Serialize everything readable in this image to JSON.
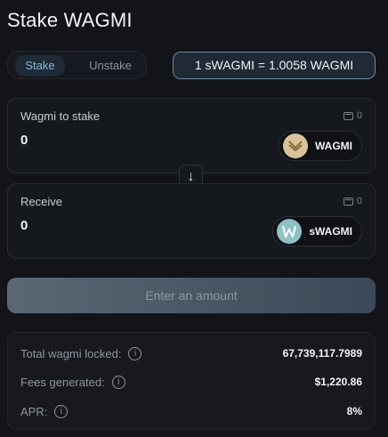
{
  "header": {
    "title": "Stake WAGMI"
  },
  "tabs": [
    {
      "label": "Stake",
      "active": true
    },
    {
      "label": "Unstake",
      "active": false
    }
  ],
  "rate": {
    "text": "1 sWAGMI = 1.0058 WAGMI"
  },
  "stake_card": {
    "label": "Wagmi to stake",
    "wallet_balance": "0",
    "amount": "0",
    "token": {
      "name": "WAGMI",
      "icon": "wagmi-logo-icon",
      "color": "#d9c39a"
    }
  },
  "swap": {
    "icon": "arrow-down-icon",
    "glyph": "↓"
  },
  "receive_card": {
    "label": "Receive",
    "wallet_balance": "0",
    "amount": "0",
    "token": {
      "name": "sWAGMI",
      "icon": "swagmi-logo-icon",
      "color": "#8fc1c4"
    }
  },
  "cta": {
    "label": "Enter an amount"
  },
  "stats": [
    {
      "label": "Total wagmi locked:",
      "value": "67,739,117.7989"
    },
    {
      "label": "Fees generated:",
      "value": "$1,220.86"
    },
    {
      "label": "APR:",
      "value": "8%"
    }
  ],
  "colors": {
    "accent": "#8fb5d8",
    "rate_border": "#6f8aa3",
    "background": "#121419"
  }
}
